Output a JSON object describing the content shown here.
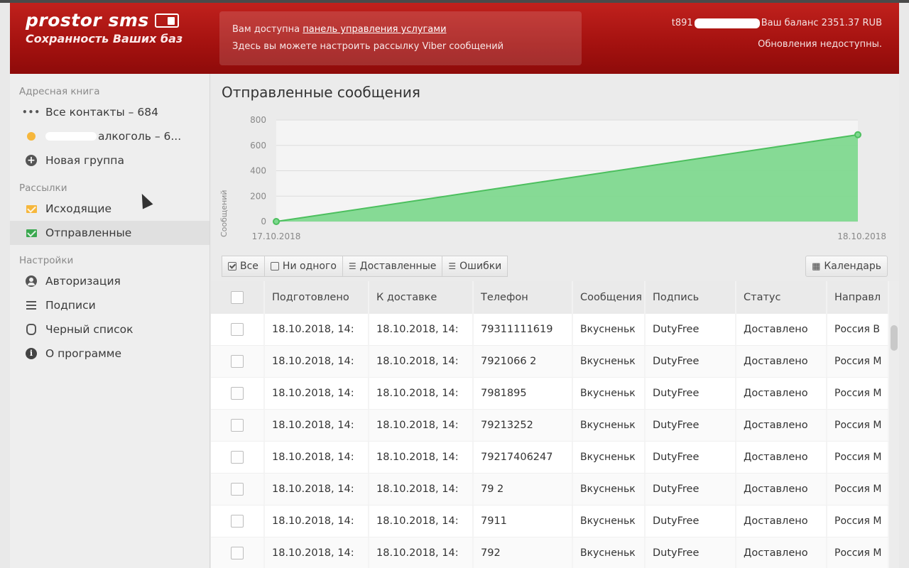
{
  "header": {
    "logo_text": "prostor sms",
    "logo_tagline": "Сохранность Ваших баз",
    "notice_prefix": "Вам доступна ",
    "notice_link": "панель управления услугами",
    "notice_line2": "Здесь вы можете настроить рассылку Viber сообщений",
    "account_prefix": "t891",
    "balance": "Ваш баланс 2351.37 RUB",
    "updates": "Обновления недоступны."
  },
  "sidebar": {
    "address_book_title": "Адресная книга",
    "address_items": [
      {
        "label": "Все контакты – 684",
        "icon": "ellipsis-icon"
      },
      {
        "label": "алкоголь – 6...",
        "icon": "orange-dot-icon"
      },
      {
        "label": "Новая группа",
        "icon": "plus-circle-icon"
      }
    ],
    "mailings_title": "Рассылки",
    "mailing_items": [
      {
        "label": "Исходящие",
        "icon": "envelope-orange-icon"
      },
      {
        "label": "Отправленные",
        "icon": "envelope-green-icon"
      }
    ],
    "settings_title": "Настройки",
    "settings_items": [
      {
        "label": "Авторизация",
        "icon": "user-circle-icon"
      },
      {
        "label": "Подписи",
        "icon": "bars-icon"
      },
      {
        "label": "Черный список",
        "icon": "hand-icon"
      },
      {
        "label": "О программе",
        "icon": "info-icon"
      }
    ]
  },
  "main": {
    "title": "Отправленные сообщения",
    "filters": {
      "all": "Все",
      "none": "Ни одного",
      "delivered": "Доставленные",
      "errors": "Ошибки"
    },
    "calendar_label": "Календарь",
    "columns": [
      "Подготовлено",
      "К доставке",
      "Телефон",
      "Сообщения",
      "Подпись",
      "Статус",
      "Направл"
    ],
    "rows": [
      [
        "18.10.2018, 14:",
        "18.10.2018, 14:",
        "79311111619",
        "Вкусненьк",
        "DutyFree",
        "Доставлено",
        "Россия В"
      ],
      [
        "18.10.2018, 14:",
        "18.10.2018, 14:",
        "7921066 2",
        "Вкусненьк",
        "DutyFree",
        "Доставлено",
        "Россия М"
      ],
      [
        "18.10.2018, 14:",
        "18.10.2018, 14:",
        "7981895",
        "Вкусненьк",
        "DutyFree",
        "Доставлено",
        "Россия М"
      ],
      [
        "18.10.2018, 14:",
        "18.10.2018, 14:",
        "79213252",
        "Вкусненьк",
        "DutyFree",
        "Доставлено",
        "Россия М"
      ],
      [
        "18.10.2018, 14:",
        "18.10.2018, 14:",
        "79217406247",
        "Вкусненьк",
        "DutyFree",
        "Доставлено",
        "Россия М"
      ],
      [
        "18.10.2018, 14:",
        "18.10.2018, 14:",
        "79 2",
        "Вкусненьк",
        "DutyFree",
        "Доставлено",
        "Россия М"
      ],
      [
        "18.10.2018, 14:",
        "18.10.2018, 14:",
        "7911",
        "Вкусненьк",
        "DutyFree",
        "Доставлено",
        "Россия М"
      ],
      [
        "18.10.2018, 14:",
        "18.10.2018, 14:",
        "792",
        "Вкусненьк",
        "DutyFree",
        "Доставлено",
        "Россия М"
      ]
    ]
  },
  "chart_data": {
    "type": "area",
    "x": [
      "17.10.2018",
      "18.10.2018"
    ],
    "values": [
      0,
      684
    ],
    "ylabel": "Сообщений",
    "ylim": [
      0,
      800
    ],
    "yticks": [
      0,
      200,
      400,
      600,
      800
    ],
    "grid": true,
    "color": "#7fd88f",
    "line_color": "#4cbf5e"
  }
}
